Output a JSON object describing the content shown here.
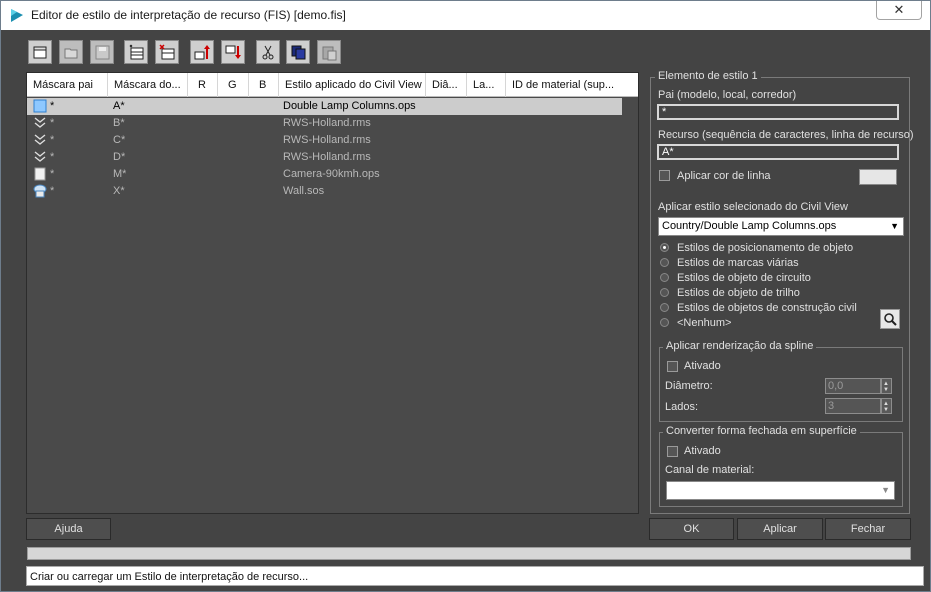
{
  "window": {
    "title": "Editor de estilo de interpretação de recurso (FIS) [demo.fis]",
    "close_label": "✕"
  },
  "toolbar": {
    "buttons": [
      "new-file-icon",
      "open-folder-icon",
      "save-disk-icon",
      "add-row-icon",
      "delete-row-icon",
      "move-up-icon",
      "move-down-icon",
      "cut-icon",
      "copy-icon",
      "paste-icon"
    ]
  },
  "table": {
    "headers": [
      "Máscara pai",
      "Máscara do...",
      "R",
      "G",
      "B",
      "Estilo aplicado do Civil View",
      "Diâ...",
      "La...",
      "ID de material (sup..."
    ],
    "rows": [
      {
        "icon": "cube-icon",
        "parent": "*",
        "mask": "A*",
        "style": "Double Lamp Columns.ops",
        "selected": true
      },
      {
        "icon": "chevron-double-down-icon",
        "parent": "*",
        "mask": "B*",
        "style": "RWS-Holland.rms",
        "selected": false
      },
      {
        "icon": "chevron-double-down-icon",
        "parent": "*",
        "mask": "C*",
        "style": "RWS-Holland.rms",
        "selected": false
      },
      {
        "icon": "chevron-double-down-icon",
        "parent": "*",
        "mask": "D*",
        "style": "RWS-Holland.rms",
        "selected": false
      },
      {
        "icon": "page-icon",
        "parent": "*",
        "mask": "M*",
        "style": "Camera-90kmh.ops",
        "selected": false
      },
      {
        "icon": "wall-icon",
        "parent": "*",
        "mask": "X*",
        "style": "Wall.sos",
        "selected": false
      }
    ]
  },
  "style_element": {
    "group_label": "Elemento de estilo 1",
    "parent_label": "Pai (modelo, local, corredor)",
    "parent_value": "*",
    "resource_label": "Recurso (sequência de caracteres, linha de recurso)",
    "resource_value": "A*",
    "apply_line_color_label": "Aplicar cor de linha",
    "apply_selected_style_label": "Aplicar estilo selecionado do Civil View",
    "style_select_value": "Country/Double Lamp Columns.ops",
    "radio_options": [
      "Estilos de posicionamento de objeto",
      "Estilos de marcas viárias",
      "Estilos de objeto de circuito",
      "Estilos de objeto de trilho",
      "Estilos de objetos de construção civil",
      "<Nenhum>"
    ],
    "radio_selected": 0,
    "spline": {
      "group_label": "Aplicar renderização da spline",
      "enabled_label": "Ativado",
      "diameter_label": "Diâmetro:",
      "diameter_value": "0,0",
      "sides_label": "Lados:",
      "sides_value": "3"
    },
    "surface": {
      "group_label": "Converter forma fechada em superfície",
      "enabled_label": "Ativado",
      "material_channel_label": "Canal de material:",
      "material_channel_value": ""
    }
  },
  "buttons": {
    "help": "Ajuda",
    "ok": "OK",
    "apply": "Aplicar",
    "close": "Fechar"
  },
  "status": {
    "text": "Criar ou carregar um Estilo de interpretação de recurso..."
  },
  "colors": {
    "panel_bg": "#444444",
    "selected_row": "#cccccc",
    "title_bg": "#ffffff"
  }
}
